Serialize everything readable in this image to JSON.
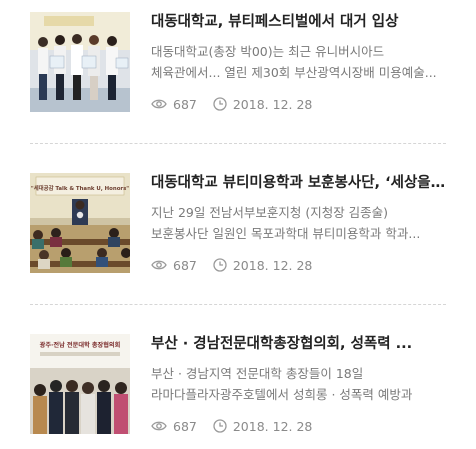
{
  "articles": [
    {
      "title": "대동대학교, 뷰티페스티벌에서 대거 입상",
      "summary_line1": "대동대학교(총장 박00)는 최근 유니버시아드",
      "summary_line2": "체육관에서... 열린 제30회 부산광역시장배 미용예술...",
      "views": "687",
      "date": "2018. 12. 28",
      "thumb_icon": "award-group-photo"
    },
    {
      "title": "대동대학교 뷰티미용학과 보훈봉사단, ‘세상을 ...",
      "summary_line1": "지난 29일 전남서부보훈지청 (지청장 김종술)",
      "summary_line2": "보훈봉사단 일원인 목포과학대 뷰티미용학과 학과...",
      "views": "687",
      "date": "2018. 12. 28",
      "thumb_icon": "lecture-hall-photo",
      "thumb_banner": "\"세대공감 Talk & Thank U, Honors\""
    },
    {
      "title": "부산 · 경남전문대학총장협의회, 성폭력 ...",
      "summary_line1": "부산 · 경남지역 전문대학 총장들이 18일",
      "summary_line2": "라마다플라자광주호텔에서 성희롱 · 성폭력 예방과",
      "views": "687",
      "date": "2018. 12. 28",
      "thumb_icon": "council-group-photo",
      "thumb_banner": "광주·전남 전문대학 총장협의회"
    }
  ],
  "colors": {
    "title": "#222222",
    "summary": "#7a7a7a",
    "meta": "#8a8a8a",
    "divider": "#d6d6d6"
  }
}
